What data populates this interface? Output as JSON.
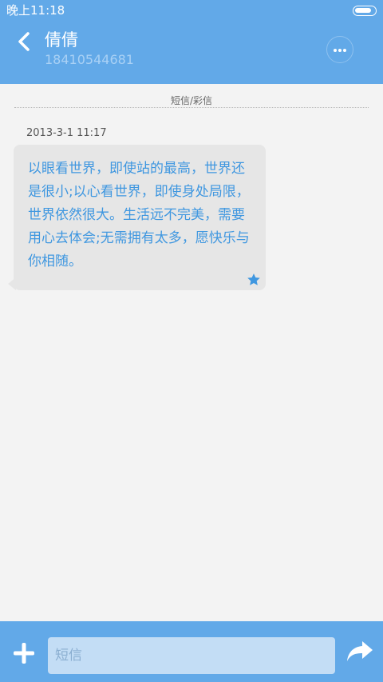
{
  "status_bar": {
    "time": "晚上11:18",
    "battery_level": 0.85
  },
  "header": {
    "contact_name": "倩倩",
    "phone_number": "18410544681",
    "icons": [
      "chevron-left-icon",
      "more-icon"
    ]
  },
  "conversation": {
    "divider_label": "短信/彩信",
    "messages": [
      {
        "timestamp": "2013-3-1 11:17",
        "text": "以眼看世界，即使站的最高，世界还是很小;以心看世界，即使身处局限，世界依然很大。生活远不完美，需要用心去体会;无需拥有太多，愿快乐与你相随。",
        "starred": true
      }
    ]
  },
  "composer": {
    "placeholder": "短信",
    "icons": [
      "plus-icon",
      "send-icon"
    ]
  },
  "colors": {
    "accent": "#62a9e8",
    "message_text": "#3f97e0",
    "bubble": "#e6e6e6",
    "background": "#f3f3f3"
  }
}
